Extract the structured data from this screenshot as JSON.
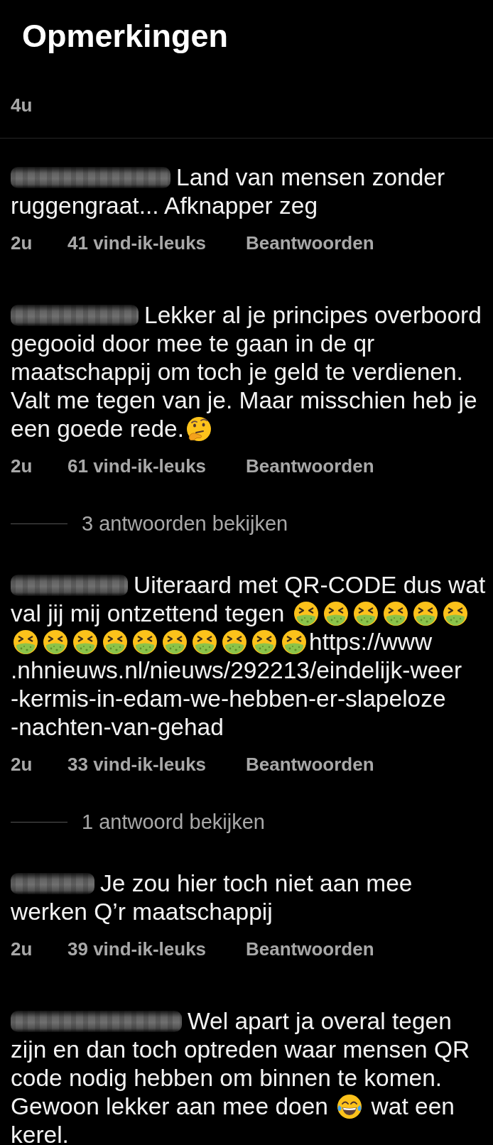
{
  "header": {
    "title": "Opmerkingen"
  },
  "post": {
    "time": "4u"
  },
  "comments": [
    {
      "body": [
        {
          "kind": "text",
          "text": "Land van mensen zonder ruggengraat... Afknapper zeg"
        }
      ],
      "time": "2u",
      "likes": "41 vind-ik-leuks",
      "reply": "Beantwoorden"
    },
    {
      "body": [
        {
          "kind": "text",
          "text": "Lekker al je principes overboord gegooid door mee te gaan in de qr maatschappij om toch je geld te verdienen. Valt me tegen van je. Maar misschien heb je een goede rede."
        },
        {
          "kind": "thinking"
        }
      ],
      "time": "2u",
      "likes": "61 vind-ik-leuks",
      "reply": "Beantwoorden",
      "view_replies": "3 antwoorden bekijken"
    },
    {
      "body": [
        {
          "kind": "text",
          "text": "Uiteraard met QR-CODE dus wat val jij mij ontzettend tegen "
        },
        {
          "kind": "nauseated"
        },
        {
          "kind": "nauseated"
        },
        {
          "kind": "nauseated"
        },
        {
          "kind": "nauseated"
        },
        {
          "kind": "nauseated"
        },
        {
          "kind": "nauseated"
        },
        {
          "kind": "nauseated"
        },
        {
          "kind": "nauseated"
        },
        {
          "kind": "nauseated"
        },
        {
          "kind": "nauseated"
        },
        {
          "kind": "nauseated"
        },
        {
          "kind": "nauseated"
        },
        {
          "kind": "nauseated"
        },
        {
          "kind": "nauseated"
        },
        {
          "kind": "nauseated"
        },
        {
          "kind": "nauseated"
        },
        {
          "kind": "url",
          "text": "https://www.nhnieuws.nl/nieuws/292213/eindelijk-weer-kermis-in-edam-we-hebben-er-slapeloze-nachten-van-gehad"
        }
      ],
      "time": "2u",
      "likes": "33 vind-ik-leuks",
      "reply": "Beantwoorden",
      "view_replies": "1 antwoord bekijken"
    },
    {
      "body": [
        {
          "kind": "text",
          "text": "Je zou hier toch niet aan mee werken Q’r maatschappij"
        }
      ],
      "time": "2u",
      "likes": "39 vind-ik-leuks",
      "reply": "Beantwoorden"
    },
    {
      "body": [
        {
          "kind": "text",
          "text": "Wel apart ja overal tegen zijn en dan toch optreden waar mensen QR code nodig hebben om binnen te komen. Gewoon lekker aan mee doen "
        },
        {
          "kind": "laughing"
        },
        {
          "kind": "text",
          "text": " wat een kerel."
        }
      ]
    }
  ]
}
